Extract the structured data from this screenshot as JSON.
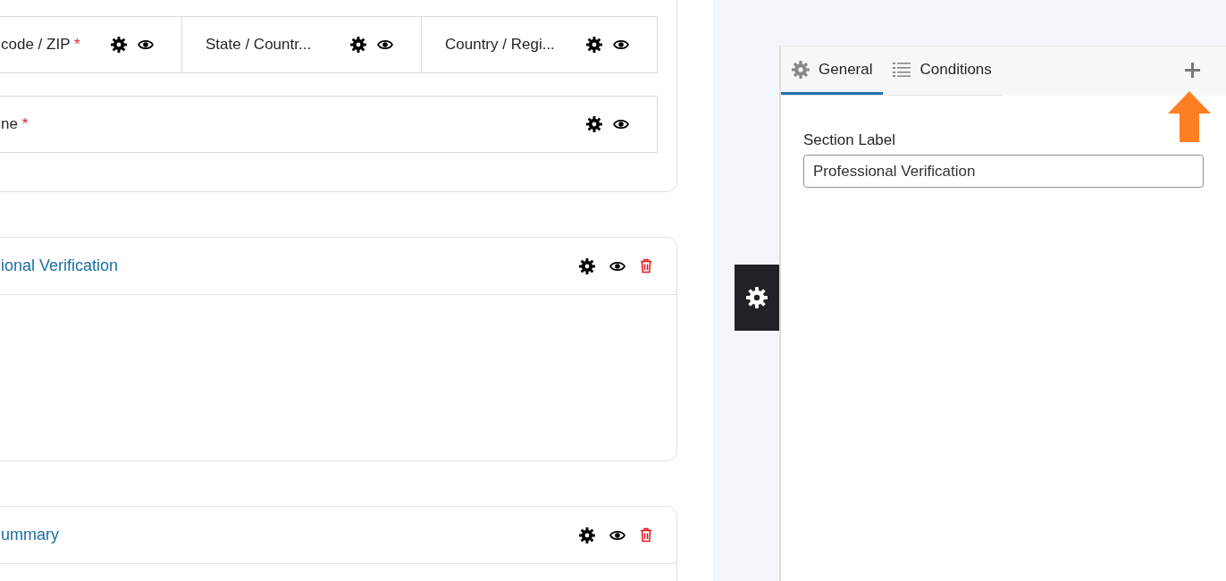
{
  "form_sections": [
    {
      "kind": "fields",
      "rows": [
        [
          {
            "label": "code / ZIP",
            "required_mark": "*"
          },
          {
            "label": "State / Countr..."
          },
          {
            "label": "Country / Regi..."
          }
        ],
        [
          {
            "label": "ne",
            "required_mark": "*"
          }
        ]
      ]
    },
    {
      "kind": "section",
      "title": "ional Verification"
    },
    {
      "kind": "section",
      "title": "ummary"
    }
  ],
  "settings_panel": {
    "tabs": [
      {
        "label": "General",
        "selected": true
      },
      {
        "label": "Conditions",
        "selected": false
      }
    ],
    "section_label": {
      "label": "Section Label",
      "value": "Professional Verification"
    }
  }
}
